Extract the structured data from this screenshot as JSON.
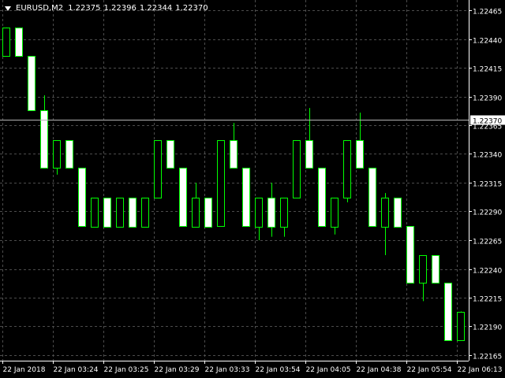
{
  "header": {
    "symbol": "EURUSD,M2",
    "open": "1.22375",
    "high": "1.22396",
    "low": "1.22344",
    "close": "1.22370"
  },
  "colors": {
    "background": "#000000",
    "grid": "#4c4c4c",
    "foreground": "#ffffff",
    "bull_outline": "#00ff00",
    "bear_fill": "#ffffff",
    "bear_outline": "#00ff00",
    "bid_line": "#b3b3b3",
    "price_label_bg": "#ffffff",
    "price_label_text": "#000000"
  },
  "chart_data": {
    "type": "candlestick",
    "title": "EURUSD,M2",
    "xlabel": "",
    "ylabel": "",
    "ylim": [
      1.2216,
      1.2247
    ],
    "grid": true,
    "current_price": 1.2237,
    "price_ticks": [
      "1.22465",
      "1.22440",
      "1.22415",
      "1.22390",
      "1.22365",
      "1.22340",
      "1.22315",
      "1.22290",
      "1.22265",
      "1.22240",
      "1.22215",
      "1.22190",
      "1.22165"
    ],
    "time_ticks": [
      "22 Jan 2018",
      "22 Jan 03:24",
      "22 Jan 03:25",
      "22 Jan 03:29",
      "22 Jan 03:33",
      "22 Jan 03:54",
      "22 Jan 04:05",
      "22 Jan 04:38",
      "22 Jan 05:54",
      "22 Jan 06:13"
    ],
    "candles": [
      {
        "o": 1.22425,
        "h": 1.2245,
        "l": 1.22425,
        "c": 1.2245
      },
      {
        "o": 1.2245,
        "h": 1.2245,
        "l": 1.22425,
        "c": 1.22425
      },
      {
        "o": 1.22425,
        "h": 1.22425,
        "l": 1.22378,
        "c": 1.22378
      },
      {
        "o": 1.22378,
        "h": 1.22391,
        "l": 1.22328,
        "c": 1.22328
      },
      {
        "o": 1.22328,
        "h": 1.22352,
        "l": 1.22322,
        "c": 1.22352
      },
      {
        "o": 1.22352,
        "h": 1.22352,
        "l": 1.22328,
        "c": 1.22328
      },
      {
        "o": 1.22328,
        "h": 1.22328,
        "l": 1.22277,
        "c": 1.22277
      },
      {
        "o": 1.22277,
        "h": 1.22302,
        "l": 1.22277,
        "c": 1.22302
      },
      {
        "o": 1.22302,
        "h": 1.22302,
        "l": 1.22277,
        "c": 1.22277
      },
      {
        "o": 1.22277,
        "h": 1.22302,
        "l": 1.22277,
        "c": 1.22302
      },
      {
        "o": 1.22302,
        "h": 1.22302,
        "l": 1.22277,
        "c": 1.22277
      },
      {
        "o": 1.22277,
        "h": 1.22302,
        "l": 1.22277,
        "c": 1.22302
      },
      {
        "o": 1.22302,
        "h": 1.22352,
        "l": 1.22302,
        "c": 1.22352
      },
      {
        "o": 1.22352,
        "h": 1.22352,
        "l": 1.22328,
        "c": 1.22328
      },
      {
        "o": 1.22328,
        "h": 1.22328,
        "l": 1.22277,
        "c": 1.22277
      },
      {
        "o": 1.22277,
        "h": 1.22315,
        "l": 1.22277,
        "c": 1.22302
      },
      {
        "o": 1.22302,
        "h": 1.22302,
        "l": 1.22277,
        "c": 1.22277
      },
      {
        "o": 1.22277,
        "h": 1.22352,
        "l": 1.22277,
        "c": 1.22352
      },
      {
        "o": 1.22352,
        "h": 1.22367,
        "l": 1.22328,
        "c": 1.22328
      },
      {
        "o": 1.22328,
        "h": 1.22328,
        "l": 1.22277,
        "c": 1.22277
      },
      {
        "o": 1.22277,
        "h": 1.22302,
        "l": 1.22265,
        "c": 1.22302
      },
      {
        "o": 1.22302,
        "h": 1.22315,
        "l": 1.22268,
        "c": 1.22277
      },
      {
        "o": 1.22277,
        "h": 1.22302,
        "l": 1.22268,
        "c": 1.22302
      },
      {
        "o": 1.22302,
        "h": 1.22352,
        "l": 1.22302,
        "c": 1.22352
      },
      {
        "o": 1.22352,
        "h": 1.2238,
        "l": 1.22328,
        "c": 1.22328
      },
      {
        "o": 1.22328,
        "h": 1.22328,
        "l": 1.22277,
        "c": 1.22277
      },
      {
        "o": 1.22277,
        "h": 1.22302,
        "l": 1.2227,
        "c": 1.22302
      },
      {
        "o": 1.22302,
        "h": 1.22352,
        "l": 1.22298,
        "c": 1.22352
      },
      {
        "o": 1.22352,
        "h": 1.22376,
        "l": 1.22328,
        "c": 1.22328
      },
      {
        "o": 1.22328,
        "h": 1.22328,
        "l": 1.22277,
        "c": 1.22277
      },
      {
        "o": 1.22277,
        "h": 1.22306,
        "l": 1.22252,
        "c": 1.22302
      },
      {
        "o": 1.22302,
        "h": 1.22302,
        "l": 1.22277,
        "c": 1.22277
      },
      {
        "o": 1.22277,
        "h": 1.22277,
        "l": 1.22228,
        "c": 1.22228
      },
      {
        "o": 1.22228,
        "h": 1.22252,
        "l": 1.22212,
        "c": 1.22252
      },
      {
        "o": 1.22252,
        "h": 1.22252,
        "l": 1.22228,
        "c": 1.22228
      },
      {
        "o": 1.22228,
        "h": 1.22228,
        "l": 1.22178,
        "c": 1.22178
      },
      {
        "o": 1.22178,
        "h": 1.22203,
        "l": 1.22178,
        "c": 1.22203
      }
    ]
  }
}
